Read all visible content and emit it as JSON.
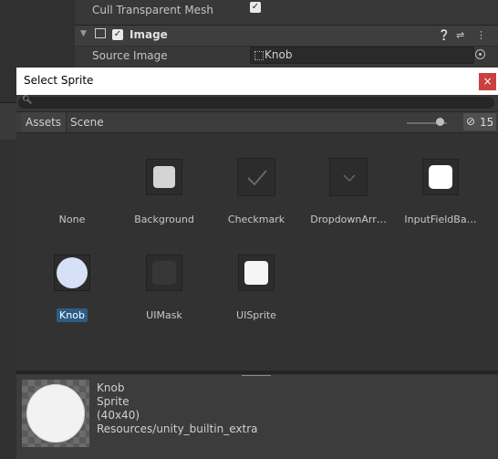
{
  "inspector": {
    "cull_label": "Cull Transparent Mesh",
    "component_title": "Image",
    "source_image_label": "Source Image",
    "source_image_value": "Knob"
  },
  "dialog": {
    "title": "Select Sprite",
    "close_label": "×",
    "tabs": [
      "Assets",
      "Scene"
    ],
    "hidden_count": "15",
    "search_placeholder": ""
  },
  "items": [
    {
      "label": "None",
      "thumb": "none",
      "selected": false
    },
    {
      "label": "Background",
      "thumb": "background",
      "selected": false
    },
    {
      "label": "Checkmark",
      "thumb": "checkmark",
      "selected": false
    },
    {
      "label": "DropdownArr…",
      "thumb": "dropdown-arrow",
      "selected": false
    },
    {
      "label": "InputFieldBa…",
      "thumb": "input-field-background",
      "selected": false
    },
    {
      "label": "Knob",
      "thumb": "knob",
      "selected": true
    },
    {
      "label": "UIMask",
      "thumb": "ui-mask",
      "selected": false
    },
    {
      "label": "UISprite",
      "thumb": "ui-sprite",
      "selected": false
    }
  ],
  "preview": {
    "name": "Knob",
    "type": "Sprite",
    "size": "(40x40)",
    "path": "Resources/unity_builtin_extra"
  },
  "colors": {
    "selection": "#2c5d87",
    "close_button": "#c94040"
  }
}
